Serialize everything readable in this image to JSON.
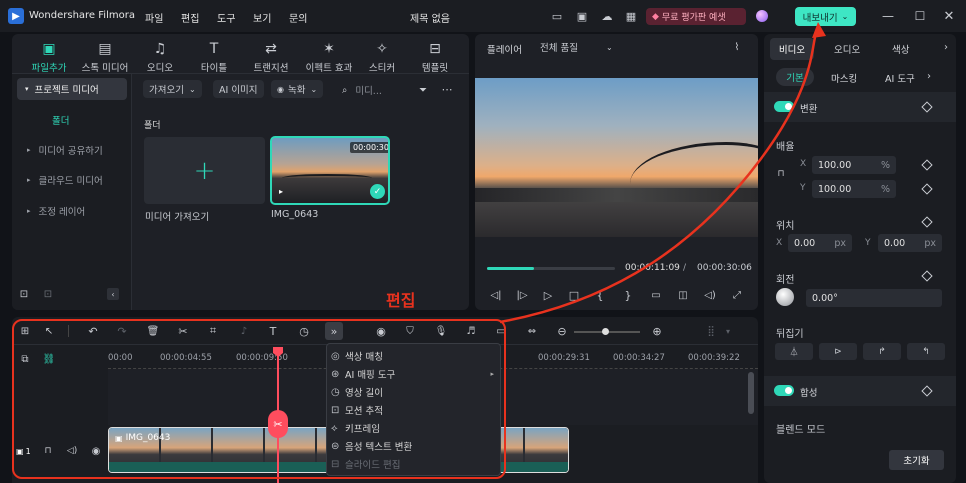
{
  "app": {
    "name": "Wondershare Filmora",
    "menus": [
      "파일",
      "편집",
      "도구",
      "보기",
      "문의"
    ],
    "project_title": "제목 없음",
    "trial": "무료 평가판 예샛",
    "export": "내보내기"
  },
  "media_tabs": [
    {
      "label": "파일추가",
      "icon": "media-icon"
    },
    {
      "label": "스톡 미디어",
      "icon": "stock-icon"
    },
    {
      "label": "오디오",
      "icon": "music-icon"
    },
    {
      "label": "타이틀",
      "icon": "title-icon"
    },
    {
      "label": "트랜지션",
      "icon": "transition-icon"
    },
    {
      "label": "이펙트 효과",
      "icon": "effects-icon"
    },
    {
      "label": "스티커",
      "icon": "sticker-icon"
    },
    {
      "label": "템플릿",
      "icon": "template-icon"
    }
  ],
  "sidebar": {
    "project_media": "프로젝트 미디어",
    "folder": "폴더",
    "items": [
      "미디어 공유하기",
      "클라우드 미디어",
      "조정 레이어"
    ]
  },
  "media_toolbar": {
    "import": "가져오기",
    "ai_image": "AI 이미지",
    "record": "녹화",
    "search_placeholder": "미디..."
  },
  "media_area": {
    "folder_label": "폴더",
    "import_tile": "미디어 가져오기",
    "clip_name": "IMG_0643",
    "clip_duration": "00:00:30"
  },
  "player": {
    "label": "플레이어",
    "quality": "전체 품질",
    "current_time": "00:00:11:09",
    "total_time": "00:00:30:06",
    "progress": 0.37
  },
  "annotation": {
    "label": "편집"
  },
  "timeline": {
    "ruler": [
      "00:00",
      "00:00:04:55",
      "00:00:09:50",
      "00:00:29:31",
      "00:00:34:27",
      "00:00:39:22"
    ],
    "clip_label": "IMG_0643",
    "track_number": "1"
  },
  "context_menu": [
    {
      "label": "색상 매칭",
      "icon": "color-match-icon",
      "disabled": false
    },
    {
      "label": "AI 매핑 도구",
      "icon": "ai-tool-icon",
      "disabled": false,
      "submenu": true
    },
    {
      "label": "영상 길이",
      "icon": "duration-icon",
      "disabled": false
    },
    {
      "label": "모션 추적",
      "icon": "motion-track-icon",
      "disabled": false
    },
    {
      "label": "키프레임",
      "icon": "keyframe-icon",
      "disabled": false
    },
    {
      "label": "음성 텍스트 변환",
      "icon": "speech-text-icon",
      "disabled": false
    },
    {
      "label": "슬라이드 편집",
      "icon": "slide-edit-icon",
      "disabled": true
    }
  ],
  "properties": {
    "tabs": [
      "비디오",
      "오디오",
      "색상"
    ],
    "subtabs": [
      "기본",
      "마스킹",
      "AI 도구"
    ],
    "transform": "변환",
    "scale": "배율",
    "scale_x": "100.00",
    "scale_y": "100.00",
    "percent": "%",
    "position": "위치",
    "pos_x": "0.00",
    "pos_y": "0.00",
    "px": "px",
    "rotation": "회전",
    "rotation_value": "0.00°",
    "flip": "뒤집기",
    "composite": "합성",
    "blend_mode": "블렌드 모드",
    "reset": "초기화",
    "x": "X",
    "y": "Y"
  },
  "colors": {
    "accent": "#2fd8b8",
    "annotation": "#e8321e",
    "playhead": "#ff4d5e",
    "bg": "#111318",
    "panel": "#1e2026"
  }
}
